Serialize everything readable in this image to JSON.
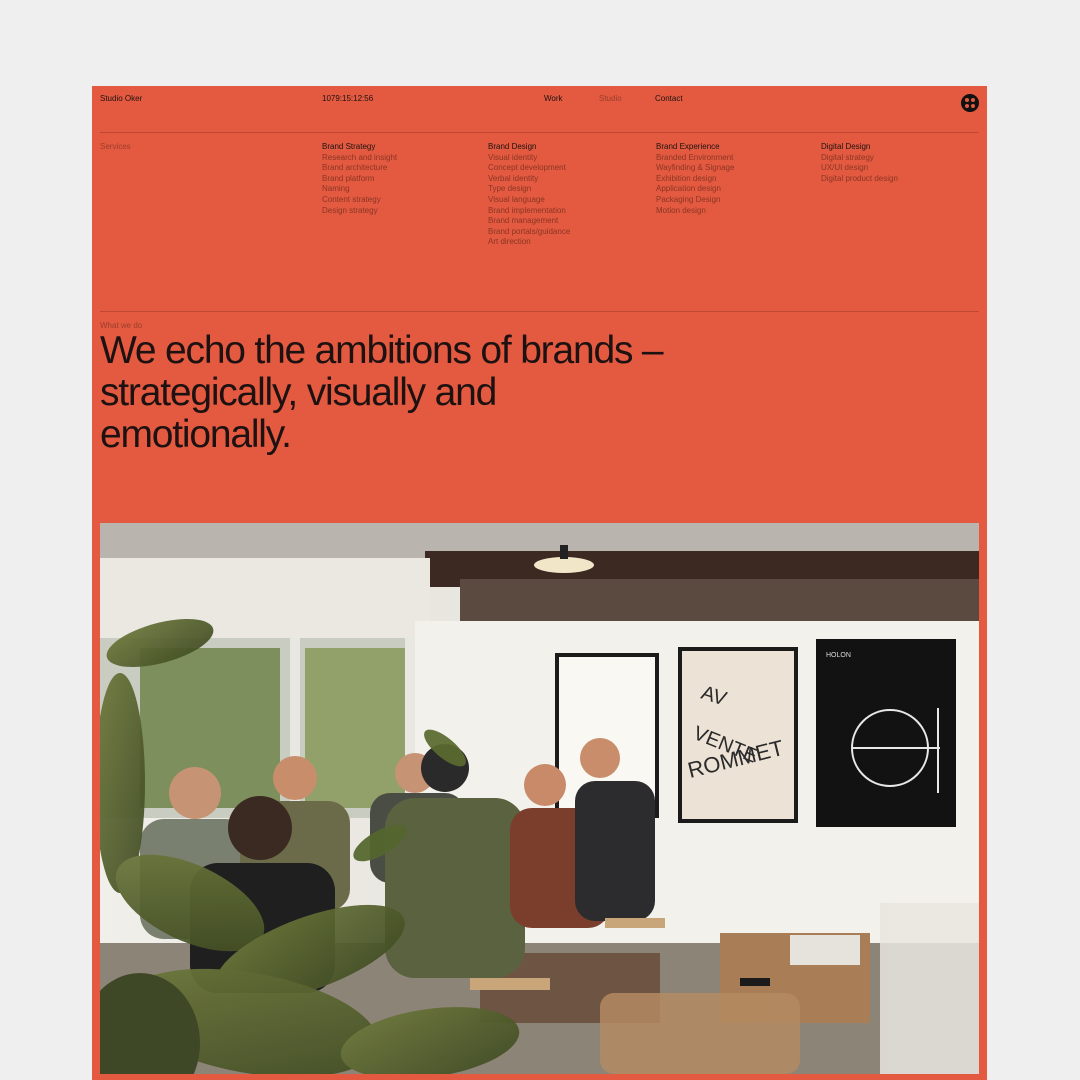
{
  "header": {
    "brand": "Studio Oker",
    "clock": "1079:15:12:56",
    "nav": {
      "work": "Work",
      "studio": "Studio",
      "contact": "Contact"
    },
    "menu_icon": "four-dot-menu-icon"
  },
  "services": {
    "label": "Services",
    "columns": [
      {
        "title": "Brand Strategy",
        "items": [
          "Research and insight",
          "Brand architecture",
          "Brand platform",
          "Naming",
          "Content strategy",
          "Design strategy"
        ]
      },
      {
        "title": "Brand Design",
        "items": [
          "Visual identity",
          "Concept development",
          "Verbal identity",
          "Type design",
          "Visual language",
          "Brand implementation",
          "Brand management",
          "Brand portals/guidance",
          "Art direction"
        ]
      },
      {
        "title": "Brand Experience",
        "items": [
          "Branded Environment",
          "Wayfinding & Signage",
          "Exhibition design",
          "Application design",
          "Packaging Design",
          "Motion design"
        ]
      },
      {
        "title": "Digital Design",
        "items": [
          "Digital strategy",
          "UX/UI design",
          "Digital product design"
        ]
      }
    ]
  },
  "intro": {
    "label": "What we do",
    "headline_lines": [
      "We echo the ambitions of brands –",
      "strategically, visually and",
      "emotionally."
    ]
  },
  "photo": {
    "posters": {
      "poster2_lines": [
        "AV",
        "VENTE",
        "ROMMET"
      ],
      "poster3_label": "HOLON"
    }
  },
  "colors": {
    "accent": "#e35a40",
    "text": "#1d1211",
    "muted": "#8a3525",
    "page_bg": "#efefef"
  }
}
